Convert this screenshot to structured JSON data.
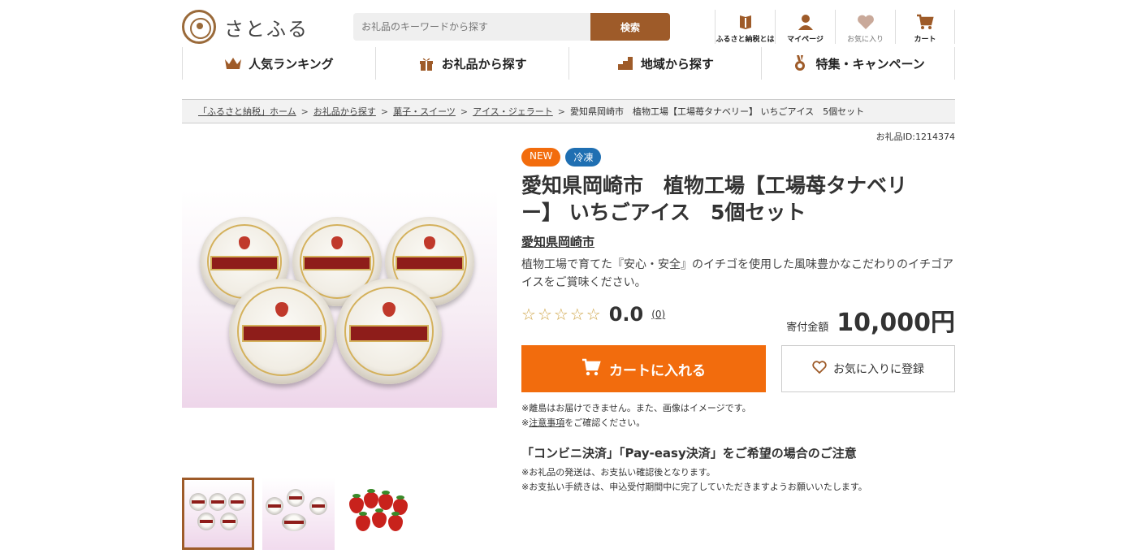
{
  "header": {
    "logo_text": "さとふる",
    "search": {
      "placeholder": "お礼品のキーワードから探す",
      "button": "検索"
    },
    "links": [
      {
        "label": "ふるさと納税とは",
        "icon": "book-icon"
      },
      {
        "label": "マイページ",
        "icon": "user-icon"
      },
      {
        "label": "お気に入り",
        "icon": "heart-icon"
      },
      {
        "label": "カート",
        "icon": "cart-icon"
      }
    ]
  },
  "nav": [
    {
      "label": "人気ランキング",
      "icon": "crown-icon"
    },
    {
      "label": "お礼品から探す",
      "icon": "gift-icon"
    },
    {
      "label": "地域から探す",
      "icon": "region-icon"
    },
    {
      "label": "特集・キャンペーン",
      "icon": "medal-icon"
    }
  ],
  "breadcrumb": {
    "items": [
      "「ふるさと納税」ホーム",
      "お礼品から探す",
      "菓子・スイーツ",
      "アイス・ジェラート"
    ],
    "current": "愛知県岡崎市　植物工場【工場苺タナベリー】 いちごアイス　5個セット",
    "separator": ">"
  },
  "product": {
    "gift_id": "お礼品ID:1214374",
    "badges": [
      "NEW",
      "冷凍"
    ],
    "title": "愛知県岡崎市　植物工場【工場苺タナベリー】 いちごアイス　5個セット",
    "city": "愛知県岡崎市",
    "description": "植物工場で育てた『安心・安全』のイチゴを使用した風味豊かなこだわりのイチゴアイスをご賞味ください。",
    "rating": {
      "value": "0.0",
      "count": "(0)",
      "stars_filled": 0,
      "stars_total": 5
    },
    "price_label": "寄付金額",
    "price": "10,000円",
    "cart_button": "カートに入れる",
    "favorite_button": "お気に入りに登録",
    "note1": "※離島はお届けできません。また、画像はイメージです。",
    "note2_prefix": "※",
    "note2_link": "注意事項",
    "note2_suffix": "をご確認ください。",
    "payment_title": "「コンビニ決済」「Pay-easy決済」をご希望の場合のご注意",
    "payment_note1": "※お礼品の発送は、お支払い確認後となります。",
    "payment_note2": "※お支払い手続きは、申込受付期間中に完了していただきますようお願いいたします。"
  },
  "colors": {
    "brand": "#9e5b29",
    "accent": "#f26c0d",
    "frozen": "#1f6fb2"
  }
}
